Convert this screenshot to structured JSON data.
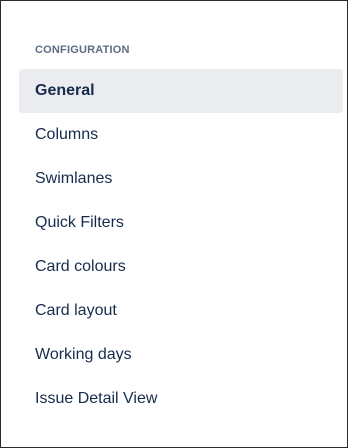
{
  "sidebar": {
    "section_heading": "CONFIGURATION",
    "items": [
      {
        "label": "General",
        "selected": true
      },
      {
        "label": "Columns",
        "selected": false
      },
      {
        "label": "Swimlanes",
        "selected": false
      },
      {
        "label": "Quick Filters",
        "selected": false
      },
      {
        "label": "Card colours",
        "selected": false
      },
      {
        "label": "Card layout",
        "selected": false
      },
      {
        "label": "Working days",
        "selected": false
      },
      {
        "label": "Issue Detail View",
        "selected": false
      }
    ]
  },
  "colors": {
    "heading_text": "#5e6c84",
    "item_text": "#172b4d",
    "selected_background": "#ebecf0",
    "border": "#2b2b2b"
  }
}
